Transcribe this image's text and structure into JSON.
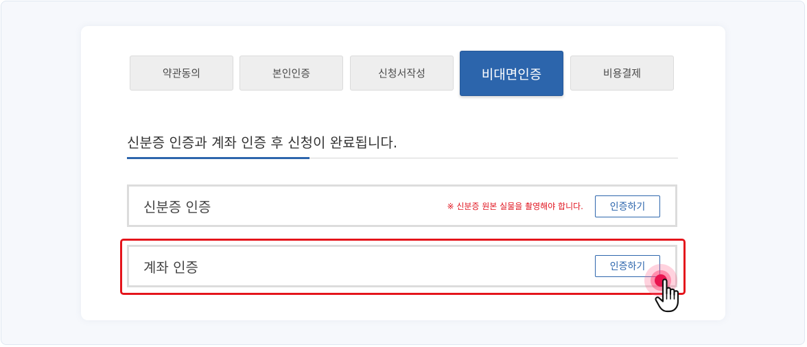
{
  "tabs": [
    {
      "label": "약관동의",
      "active": false
    },
    {
      "label": "본인인증",
      "active": false
    },
    {
      "label": "신청서작성",
      "active": false
    },
    {
      "label": "비대면인증",
      "active": true
    },
    {
      "label": "비용결제",
      "active": false
    }
  ],
  "headline": "신분증 인증과 계좌 인증 후 신청이 완료됩니다.",
  "rows": [
    {
      "title": "신분증 인증",
      "note": "※ 신분증 원본 실물을 촬영해야 합니다.",
      "button": "인증하기"
    },
    {
      "title": "계좌 인증",
      "button": "인증하기"
    }
  ],
  "colors": {
    "accent": "#2c65ac",
    "warning": "#e0121d",
    "highlight": "#e4141b"
  }
}
